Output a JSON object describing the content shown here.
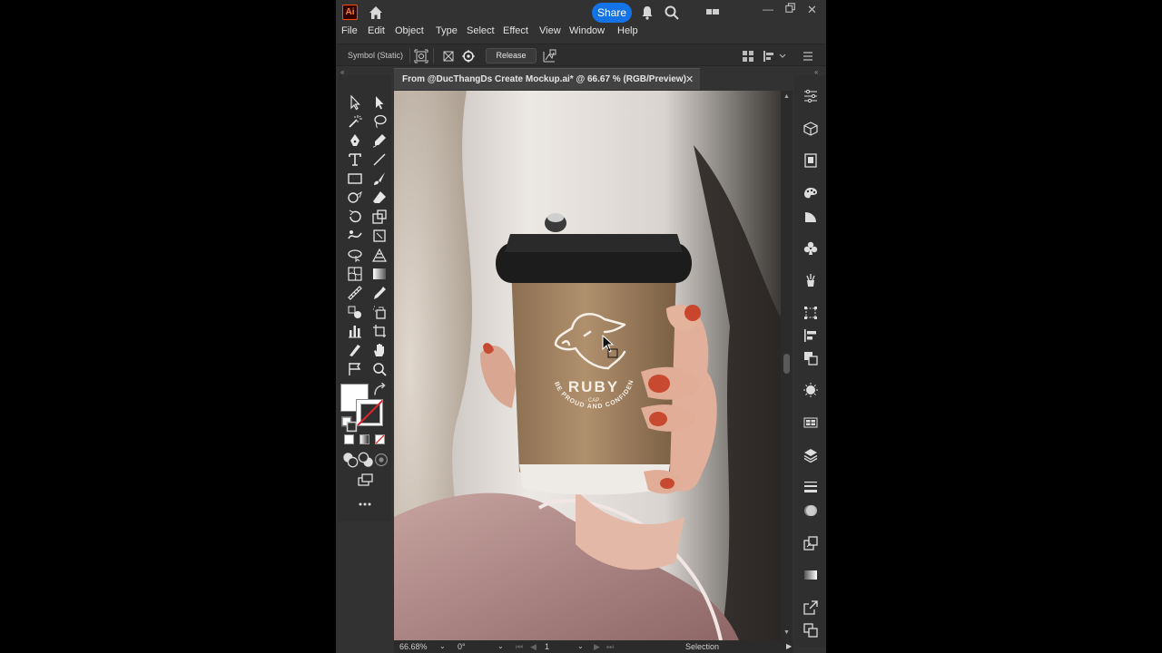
{
  "app": {
    "logo_text": "Ai",
    "share_label": "Share"
  },
  "menu": [
    "File",
    "Edit",
    "Object",
    "Type",
    "Select",
    "Effect",
    "View",
    "Window",
    "Help"
  ],
  "control_bar": {
    "selection_type": "Symbol (Static)",
    "release_label": "Release"
  },
  "document": {
    "tab_title": "From @DucThangDs Create Mockup.ai* @ 66.67 % (RGB/Preview)",
    "close_glyph": "✕"
  },
  "artwork": {
    "brand": "RUBY",
    "sub": "· CAP ·",
    "tagline": "BE PROUD AND CONFIDENT"
  },
  "status": {
    "zoom": "66.68%",
    "rotation": "0°",
    "artboard": "1",
    "tool": "Selection"
  },
  "colors": {
    "accent": "#1473e6",
    "fill": "#ffffff",
    "stroke_none_slash": "#e0262b",
    "cup_kraft": "#a88763",
    "lid": "#1c1c1c"
  },
  "icons": {
    "titlebar": [
      "home-icon",
      "bell-icon",
      "search-icon",
      "workspace-icon",
      "minimize-icon",
      "restore-icon",
      "close-icon"
    ],
    "dock": [
      "properties-icon",
      "3d-icon",
      "libraries-icon",
      "color-icon",
      "color-guide-icon",
      "symbols-icon",
      "brushes-icon",
      "transform-icon",
      "align-icon",
      "pathfinder-icon",
      "appearance-icon",
      "graphic-styles-icon",
      "layers-icon",
      "stroke-icon",
      "transparency-icon",
      "asset-export-icon",
      "gradient-icon",
      "export-icon",
      "artboards-icon"
    ]
  }
}
